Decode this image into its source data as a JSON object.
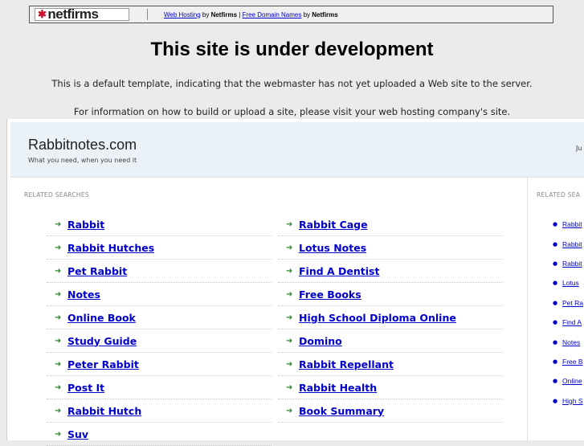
{
  "netfirms_bar": {
    "logo": "netfirms",
    "web_hosting": "Web Hosting",
    "by1": " by ",
    "netfirms1": "Netfirms",
    "pipe": " | ",
    "free_domain": "Free Domain Names",
    "by2": " by ",
    "netfirms2": "Netfirms"
  },
  "dev": {
    "title": "This site is under development",
    "line1": "This is a default template, indicating that the webmaster has not yet uploaded a Web site to the server.",
    "line2": "For information on how to build or upload a site, please visit your web hosting company's site."
  },
  "parked": {
    "site_name": "Rabbitnotes.com",
    "tagline": "What you need, when you need it",
    "header_right": "Ju",
    "related_label": "RELATED SEARCHES",
    "side_label": "RELATED SEA",
    "col1": [
      "Rabbit",
      "Rabbit Hutches",
      "Pet Rabbit",
      "Notes",
      "Online Book",
      "Study Guide",
      "Peter Rabbit",
      "Post It",
      "Rabbit Hutch",
      "Suv"
    ],
    "col2": [
      "Rabbit Cage",
      "Lotus Notes",
      "Find A Dentist",
      "Free Books",
      "High School Diploma Online",
      "Domino",
      "Rabbit Repellant",
      "Rabbit Health",
      "Book Summary"
    ],
    "side": [
      "Rabbit",
      "Rabbit",
      "Rabbit",
      "Lotus",
      "Pet Ra",
      "Find A",
      "Notes",
      "Free B",
      "Online",
      "High S"
    ]
  },
  "icons": {
    "list_arrow": "arrow-right-icon",
    "side_bullet": "bullet-icon"
  },
  "colors": {
    "link": "#0000cc",
    "arrow": "#2f8a2f",
    "header_bg": "#eaf2f8"
  }
}
